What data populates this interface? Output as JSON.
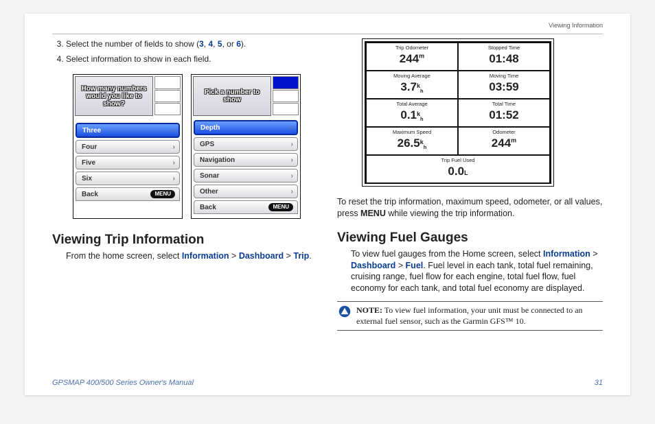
{
  "header": {
    "breadcrumb": "Viewing Information"
  },
  "steps": {
    "s3_pre": "Select the number of fields to show (",
    "s3_nums": [
      "3",
      "4",
      "5",
      "6"
    ],
    "s3_post": ").",
    "s4": "Select information to show in each field."
  },
  "scr1": {
    "msg": "How many numbers would you like to show?",
    "items": [
      "Three",
      "Four",
      "Five",
      "Six"
    ],
    "back": "Back",
    "menu": "MENU"
  },
  "scr2": {
    "msg": "Pick a number to show",
    "items": [
      "Depth",
      "GPS",
      "Navigation",
      "Sonar",
      "Other"
    ],
    "back": "Back",
    "menu": "MENU"
  },
  "sec_trip": {
    "title": "Viewing Trip Information",
    "body_pre": "From the home screen, select ",
    "nav": [
      "Information",
      "Dashboard",
      "Trip"
    ],
    "period": "."
  },
  "trip": {
    "cells": [
      {
        "lab": "Trip Odometer",
        "val": "244",
        "unit_sup": "m"
      },
      {
        "lab": "Stopped Time",
        "val": "01:48"
      },
      {
        "lab": "Moving Average",
        "val": "3.7",
        "unit_side": "k",
        "unit_side2": "h"
      },
      {
        "lab": "Moving Time",
        "val": "03:59"
      },
      {
        "lab": "Total Average",
        "val": "0.1",
        "unit_side": "k",
        "unit_side2": "h"
      },
      {
        "lab": "Total Time",
        "val": "01:52"
      },
      {
        "lab": "Maximum Speed",
        "val": "26.5",
        "unit_side": "k",
        "unit_side2": "h"
      },
      {
        "lab": "Odometer",
        "val": "244",
        "unit_sup": "m"
      }
    ],
    "fuel": {
      "lab": "Trip Fuel Used",
      "val": "0.0",
      "unit": "L"
    }
  },
  "reset": {
    "pre": "To reset the trip information, maximum speed, odometer, or all values, press ",
    "menu": "MENU",
    "post": " while viewing the trip information."
  },
  "sec_fuel": {
    "title": "Viewing Fuel Gauges",
    "body_pre": "To view fuel gauges from the Home screen, select ",
    "nav": [
      "Information",
      "Dashboard",
      "Fuel"
    ],
    "body_post": ". Fuel level in each tank, total fuel remaining, cruising range, fuel flow for each engine, total fuel flow, fuel economy for each tank, and total fuel economy are displayed."
  },
  "note": {
    "lead": "NOTE:",
    "body": " To view fuel information, your unit must be connected to an external fuel sensor, such as the Garmin GFS™ 10."
  },
  "footer": {
    "left": "GPSMAP 400/500 Series Owner's Manual",
    "right": "31"
  }
}
